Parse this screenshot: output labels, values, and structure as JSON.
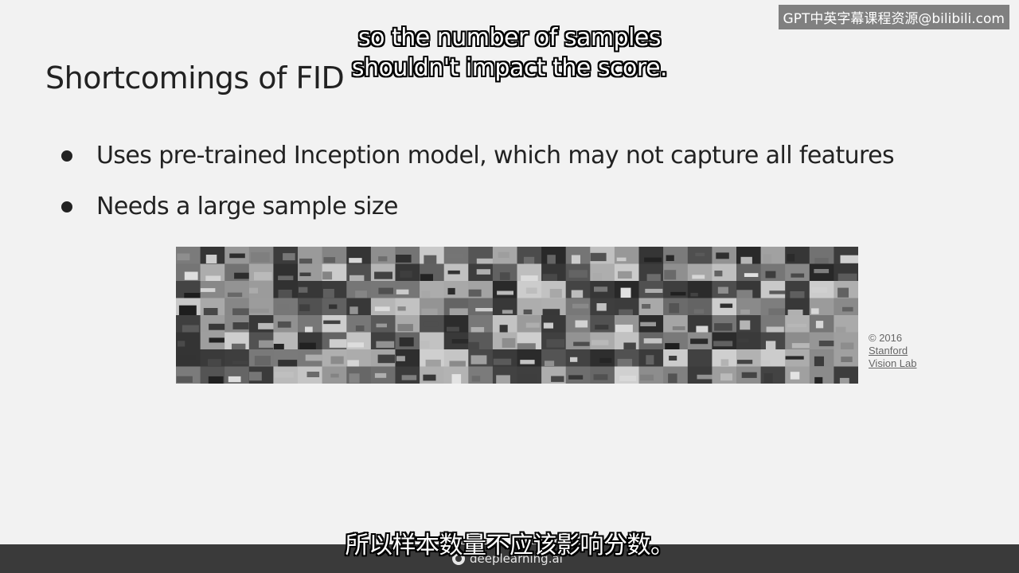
{
  "slide": {
    "title": "Shortcomings of FID",
    "bullets": [
      "Uses pre-trained Inception model, which may not capture all features",
      "Needs a large sample size"
    ],
    "credit": {
      "year": "© 2016",
      "org_line1": "Stanford",
      "org_line2": "Vision Lab"
    }
  },
  "subtitles": {
    "english_line1": "so the number of samples",
    "english_line2": "shouldn't impact the score.",
    "chinese": "所以样本数量不应该影响分数。"
  },
  "watermark": {
    "text": "GPT中英字幕课程资源@bilibili.com"
  },
  "brand": {
    "name": "deeplearning.ai",
    "icon": "deeplearning-logo-icon"
  },
  "colors": {
    "slide_bg": "#f2f2f2",
    "text": "#222222",
    "bottom_bar": "#3a3a3a"
  }
}
